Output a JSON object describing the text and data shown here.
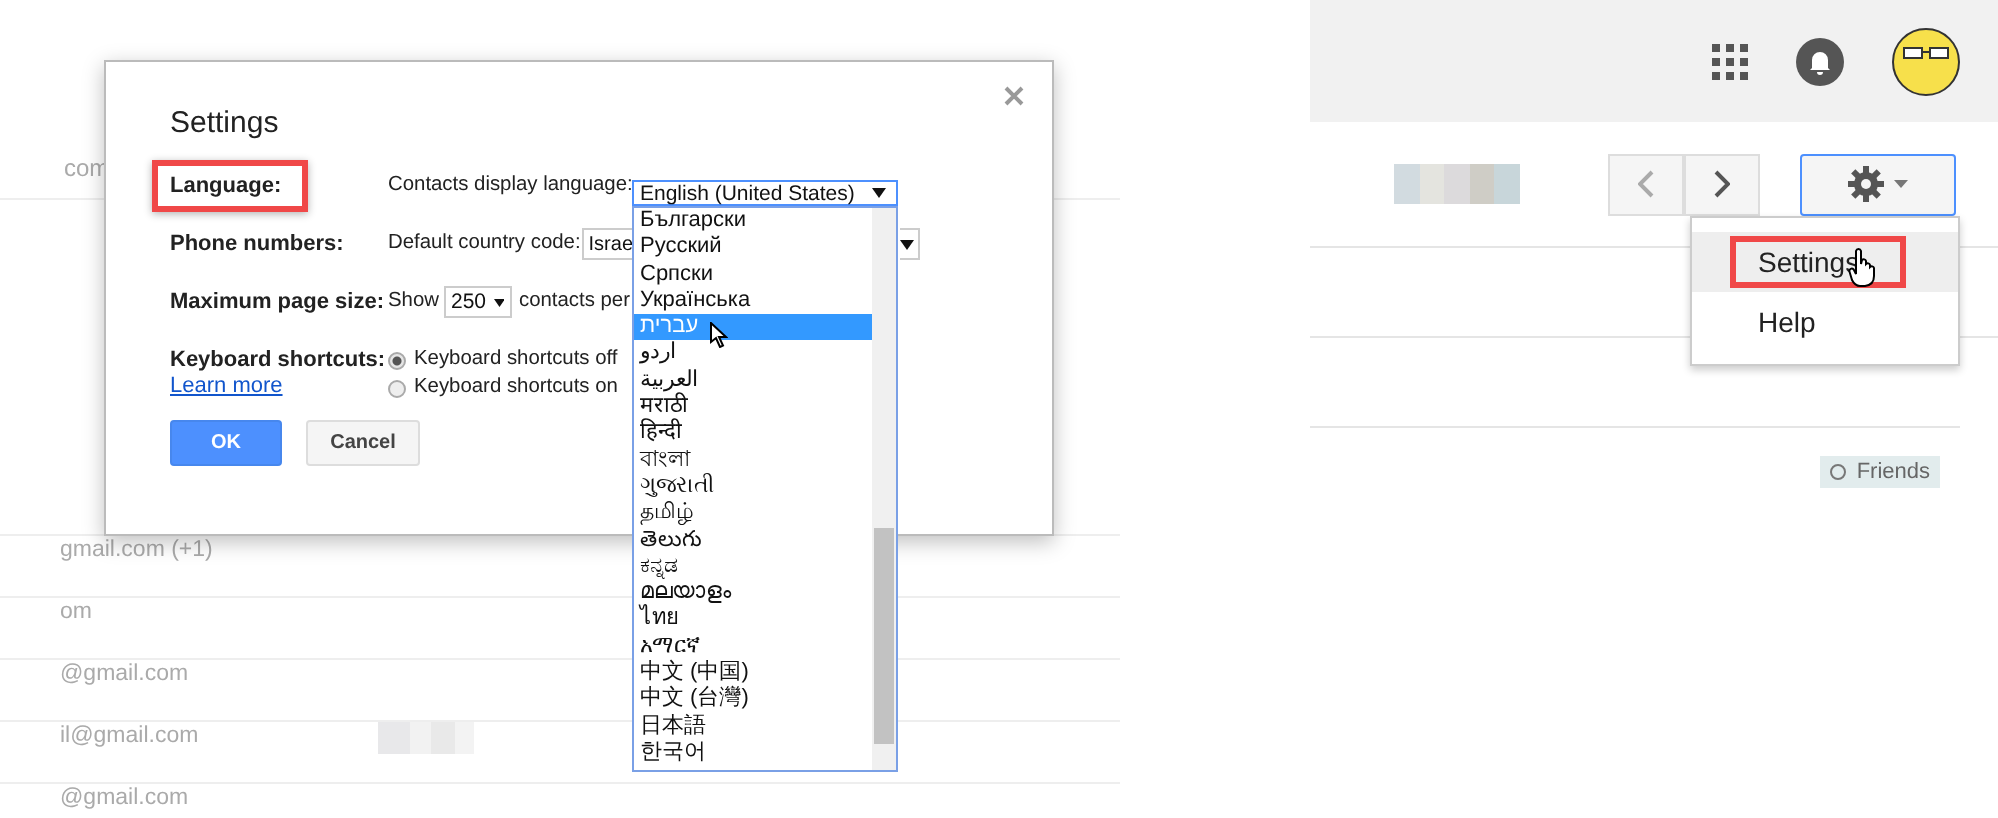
{
  "contacts_list": {
    "rows": [
      {
        "email": "com",
        "name_blurred": false
      },
      {
        "email": "gmail.com (+1)",
        "name_blurred": false
      },
      {
        "email": "om",
        "name_blurred": false
      },
      {
        "email": "@gmail.com",
        "name_blurred": false
      },
      {
        "email": "il@gmail.com",
        "name_blurred": true
      },
      {
        "email": "@gmail.com",
        "name_blurred": false
      }
    ]
  },
  "settings_dialog": {
    "title": "Settings",
    "rows": [
      {
        "kind": "select",
        "label": "Language:",
        "highlighted": true,
        "prefix": "Contacts display language:",
        "value": "English (United States)"
      },
      {
        "kind": "select",
        "label": "Phone numbers:",
        "highlighted": false,
        "prefix": "Default country code:",
        "value": "Israe"
      },
      {
        "kind": "inline_select",
        "label": "Maximum page size:",
        "highlighted": false,
        "prefix": "Show",
        "value": "250",
        "suffix": "contacts per"
      },
      {
        "kind": "radios",
        "label": "Keyboard shortcuts:",
        "highlighted": false,
        "link": "Learn more",
        "options": [
          {
            "label": "Keyboard shortcuts off",
            "selected": true
          },
          {
            "label": "Keyboard shortcuts on",
            "selected": false
          }
        ]
      }
    ],
    "buttons": [
      {
        "label": "OK",
        "kind": "primary"
      },
      {
        "label": "Cancel",
        "kind": "secondary"
      }
    ]
  },
  "language_list": {
    "items": [
      {
        "label": "Български",
        "selected": false
      },
      {
        "label": "Русский",
        "selected": false
      },
      {
        "label": "Српски",
        "selected": false
      },
      {
        "label": "Українська",
        "selected": false
      },
      {
        "label": "עברית",
        "selected": true
      },
      {
        "label": "اردو",
        "selected": false
      },
      {
        "label": "العربية",
        "selected": false
      },
      {
        "label": "मराठी",
        "selected": false
      },
      {
        "label": "हिन्दी",
        "selected": false
      },
      {
        "label": "বাংলা",
        "selected": false
      },
      {
        "label": "ગુજરાતી",
        "selected": false
      },
      {
        "label": "தமிழ்",
        "selected": false
      },
      {
        "label": "తెలుగు",
        "selected": false
      },
      {
        "label": "ಕನ್ನಡ",
        "selected": false
      },
      {
        "label": "മലയാളം",
        "selected": false
      },
      {
        "label": "ไทย",
        "selected": false
      },
      {
        "label": "አማርኛ",
        "selected": false
      },
      {
        "label": "中文 (中国)",
        "selected": false
      },
      {
        "label": "中文 (台灣)",
        "selected": false
      },
      {
        "label": "日本語",
        "selected": false
      },
      {
        "label": "한국어",
        "selected": false
      }
    ]
  },
  "gear_menu": {
    "items": [
      {
        "label": "Settings",
        "hovered": true,
        "highlighted": true
      },
      {
        "label": "Help",
        "hovered": false,
        "highlighted": false
      }
    ]
  },
  "label_chip": {
    "label": "Friends"
  }
}
